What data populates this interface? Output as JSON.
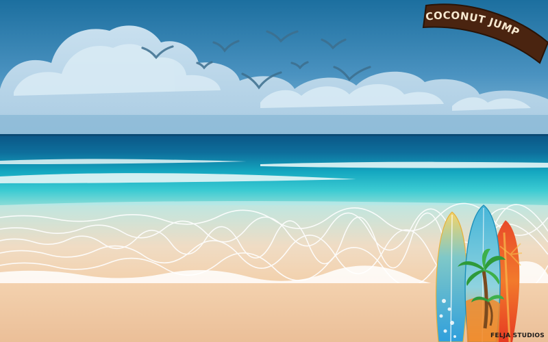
{
  "game": {
    "title": "COCONUT JUMP",
    "studio": "FELJA STUDIOS"
  },
  "colors": {
    "sky_top": "#1c6f9f",
    "sky_bottom": "#7fb6d6",
    "sea_deep": "#0a5b8a",
    "sea_shallow": "#2cc2cf",
    "sand": "#f0c9a3",
    "title_badge": "#4a2410",
    "title_text": "#f6e8d0"
  }
}
